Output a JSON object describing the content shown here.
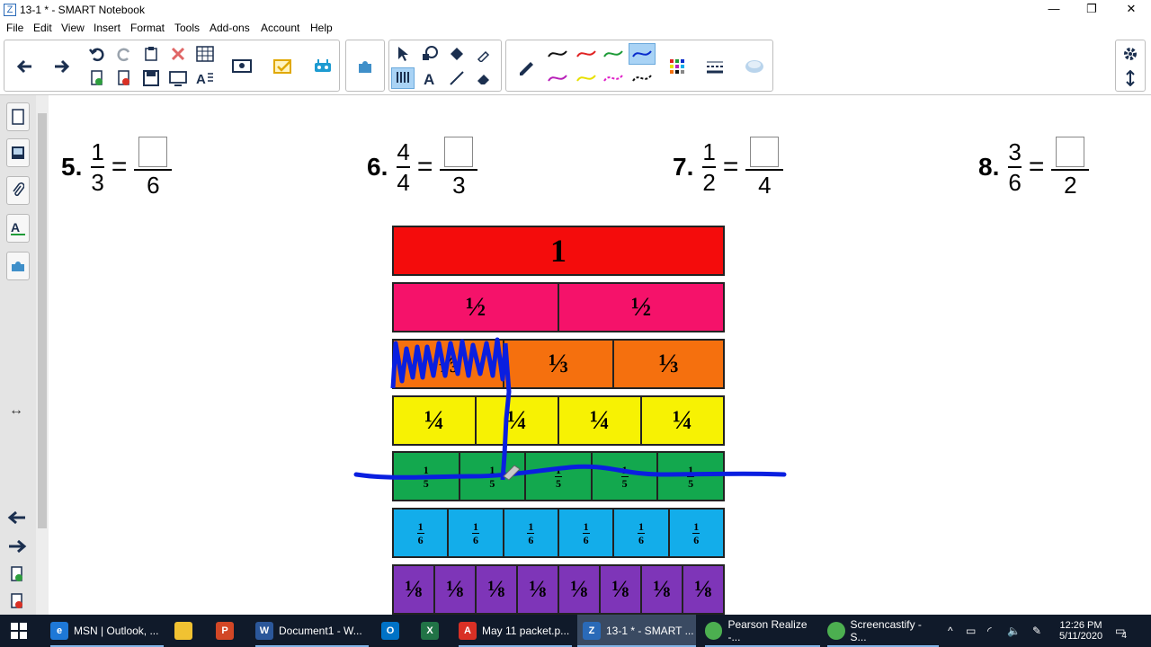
{
  "window": {
    "title": "13-1 * - SMART Notebook",
    "icon": "smart-notebook-icon"
  },
  "menu": [
    "File",
    "Edit",
    "View",
    "Insert",
    "Format",
    "Tools",
    "Add-ons",
    "Account",
    "Help"
  ],
  "problems": [
    {
      "number": "5.",
      "num": "1",
      "den": "3",
      "ans_den": "6"
    },
    {
      "number": "6.",
      "num": "4",
      "den": "4",
      "ans_den": "3"
    },
    {
      "number": "7.",
      "num": "1",
      "den": "2",
      "ans_den": "4"
    },
    {
      "number": "8.",
      "num": "3",
      "den": "6",
      "ans_den": "2"
    }
  ],
  "fraction_bars": [
    {
      "color": "#f40c0c",
      "labels": [
        "1"
      ]
    },
    {
      "color": "#f5126a",
      "labels": [
        "½",
        "½"
      ]
    },
    {
      "color": "#f5700e",
      "labels": [
        "⅓",
        "⅓",
        "⅓"
      ]
    },
    {
      "color": "#f7f203",
      "labels": [
        "¼",
        "¼",
        "¼",
        "¼"
      ]
    },
    {
      "color": "#13a84e",
      "labels": [
        "1/5",
        "1/5",
        "1/5",
        "1/5",
        "1/5"
      ]
    },
    {
      "color": "#13adea",
      "labels": [
        "1/6",
        "1/6",
        "1/6",
        "1/6",
        "1/6",
        "1/6"
      ]
    },
    {
      "color": "#7e35b8",
      "labels": [
        "⅛",
        "⅛",
        "⅛",
        "⅛",
        "⅛",
        "⅛",
        "⅛",
        "⅛"
      ]
    }
  ],
  "taskbar": {
    "items": [
      {
        "label": "MSN | Outlook, ...",
        "icon": "edge-icon",
        "color": "#1e78d7"
      },
      {
        "label": "",
        "icon": "file-explorer-icon",
        "color": "#f1c232"
      },
      {
        "label": "",
        "icon": "powerpoint-icon",
        "color": "#d24726"
      },
      {
        "label": "Document1 - W...",
        "icon": "word-icon",
        "color": "#2b579a"
      },
      {
        "label": "",
        "icon": "outlook-icon",
        "color": "#0072c6"
      },
      {
        "label": "",
        "icon": "excel-icon",
        "color": "#217346"
      },
      {
        "label": "May 11 packet.p...",
        "icon": "pdf-icon",
        "color": "#d93025"
      },
      {
        "label": "13-1 * - SMART ...",
        "icon": "smart-notebook-icon",
        "color": "#2a6ab8",
        "active": true
      },
      {
        "label": "Pearson Realize -...",
        "icon": "chrome-icon",
        "color": "#4caf50"
      },
      {
        "label": "Screencastify - S...",
        "icon": "chrome-icon",
        "color": "#4caf50"
      }
    ],
    "time": "12:26 PM",
    "date": "5/11/2020",
    "notifications": "4"
  }
}
